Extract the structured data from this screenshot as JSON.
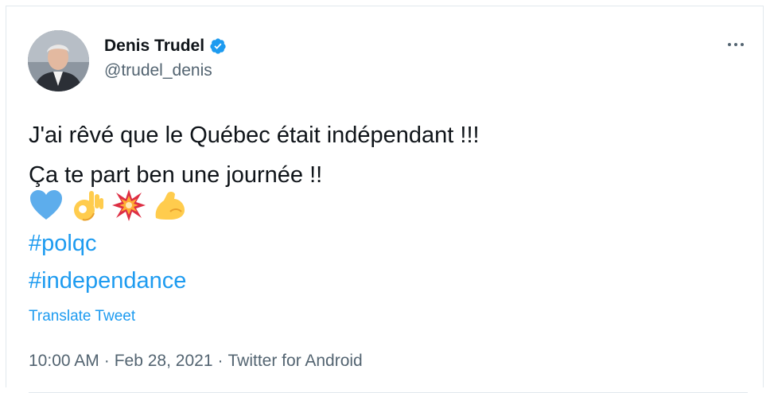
{
  "author": {
    "display_name": "Denis Trudel",
    "handle": "@trudel_denis",
    "verified": true
  },
  "tweet": {
    "text_lines": [
      "J'ai rêvé que le Québec était indépendant !!!",
      "Ça te part ben une journée !!"
    ],
    "emojis": [
      "blue-heart-icon",
      "ok-hand-icon",
      "collision-icon",
      "flexed-biceps-icon"
    ],
    "hashtags": [
      "#polqc",
      "#independance"
    ],
    "translate_label": "Translate Tweet"
  },
  "meta": {
    "time": "10:00 AM",
    "sep1": "·",
    "date": "Feb 28, 2021",
    "sep2": "·",
    "source": "Twitter for Android"
  },
  "colors": {
    "link": "#1d9bf0",
    "secondary_text": "#536471",
    "primary_text": "#0f1419",
    "border": "#e1e8ed"
  }
}
